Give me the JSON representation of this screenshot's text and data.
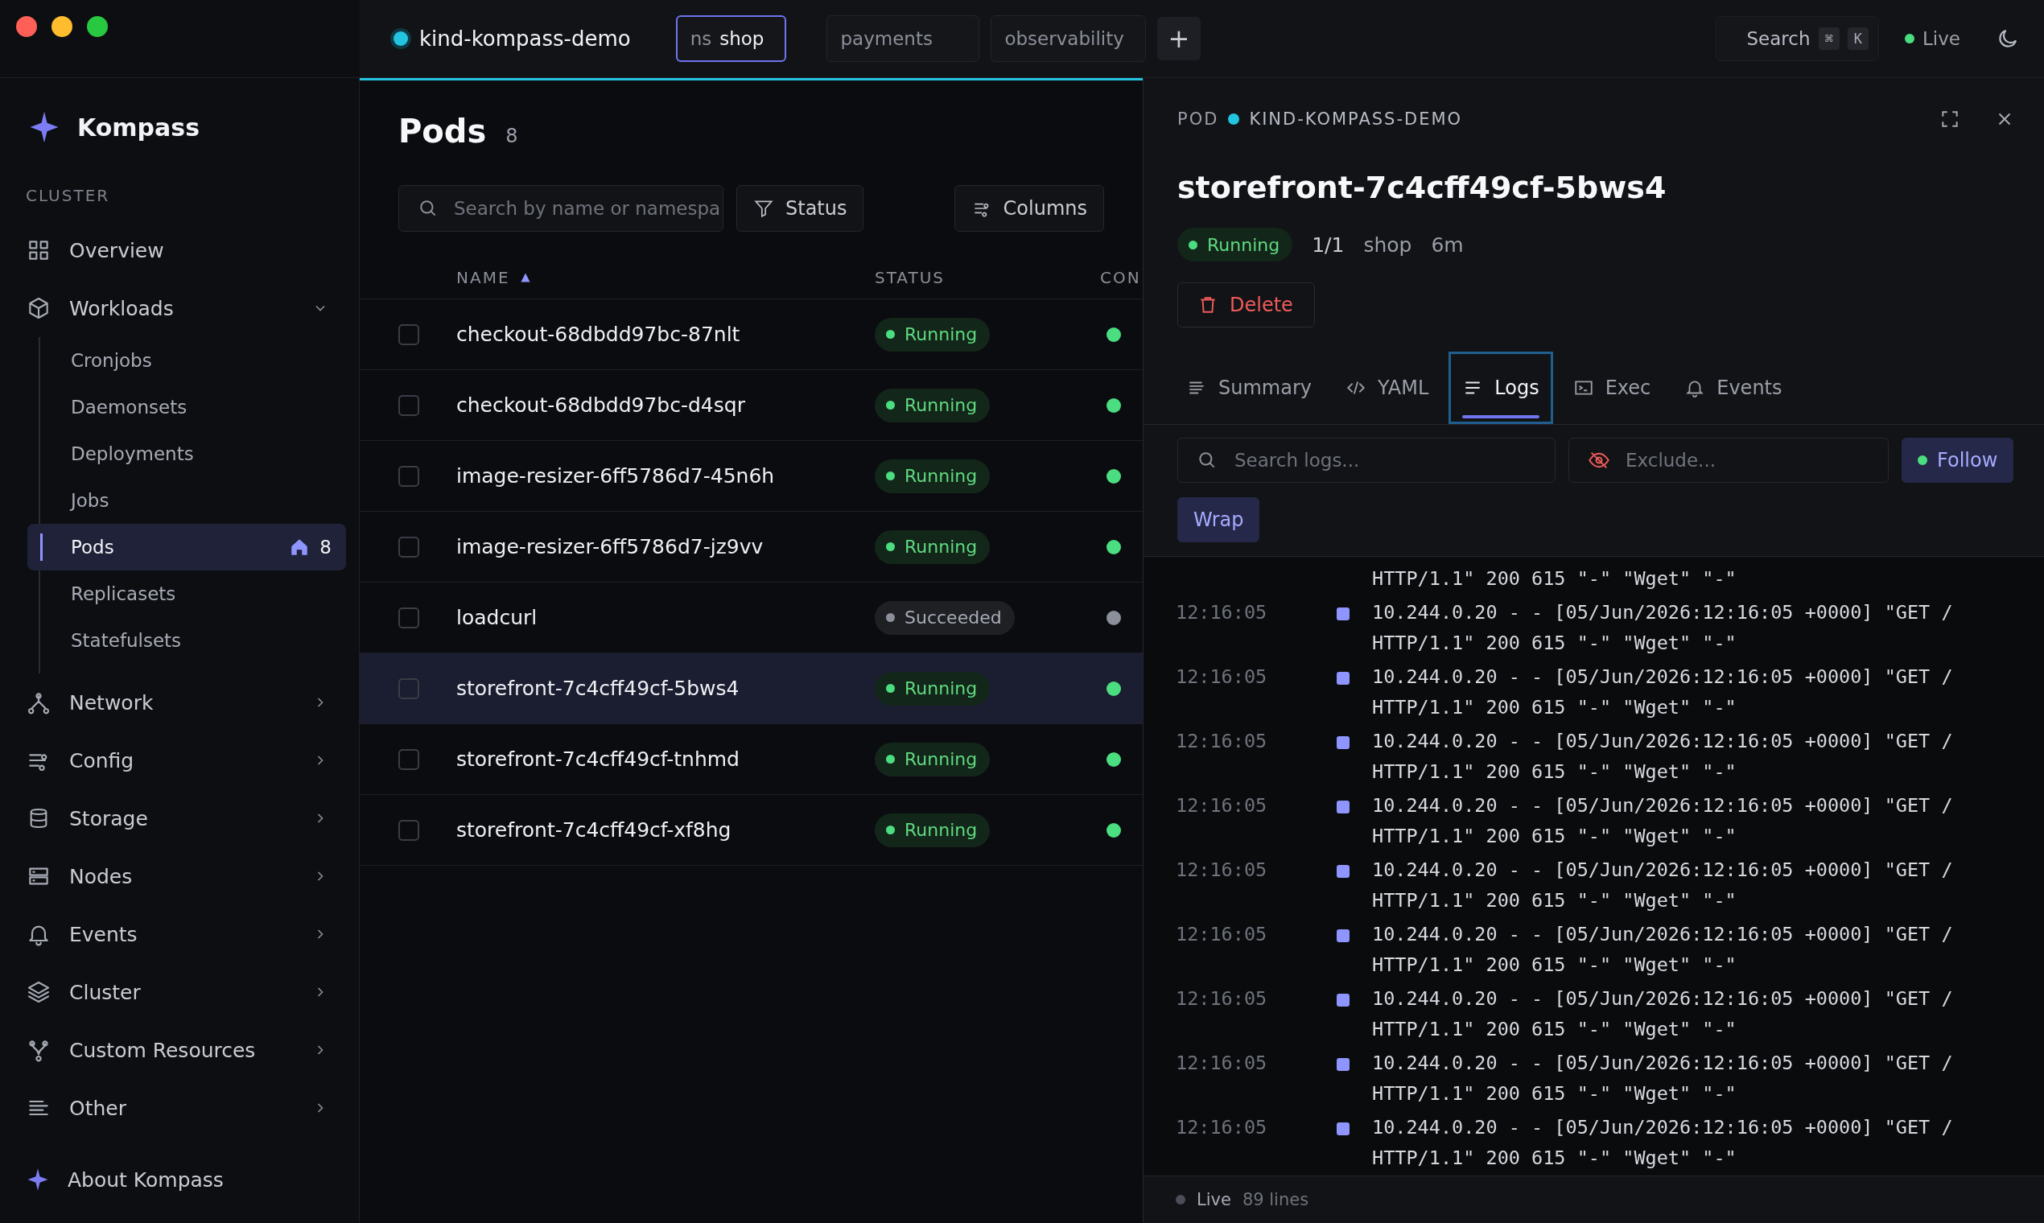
{
  "topbar": {
    "cluster": "kind-kompass-demo",
    "namespaces": [
      {
        "prefix": "ns",
        "label": "shop",
        "selected": true
      },
      {
        "label": "payments",
        "selected": false
      },
      {
        "label": "observability",
        "selected": false
      }
    ],
    "add": "+",
    "search": {
      "label": "Search",
      "keys": [
        "⌘",
        "K"
      ]
    },
    "live": "Live"
  },
  "sidebar": {
    "brand": "Kompass",
    "section": "CLUSTER",
    "items": [
      {
        "label": "Overview"
      },
      {
        "label": "Workloads",
        "expanded": true,
        "children": [
          {
            "label": "Cronjobs",
            "selected": false
          },
          {
            "label": "Daemonsets",
            "selected": false
          },
          {
            "label": "Deployments",
            "selected": false
          },
          {
            "label": "Jobs",
            "selected": false
          },
          {
            "label": "Pods",
            "selected": true,
            "badge": "8"
          },
          {
            "label": "Replicasets",
            "selected": false
          },
          {
            "label": "Statefulsets",
            "selected": false
          }
        ]
      },
      {
        "label": "Network",
        "expanded": false
      },
      {
        "label": "Config",
        "expanded": false
      },
      {
        "label": "Storage",
        "expanded": false
      },
      {
        "label": "Nodes",
        "expanded": false
      },
      {
        "label": "Events",
        "expanded": false
      },
      {
        "label": "Cluster",
        "expanded": false
      },
      {
        "label": "Custom Resources",
        "expanded": false
      },
      {
        "label": "Other",
        "expanded": false
      }
    ],
    "footer": "About Kompass"
  },
  "pods": {
    "title": "Pods",
    "count": "8",
    "search": {
      "placeholder": "Search by name or namespa"
    },
    "filter": "Status",
    "columns_button": "Columns",
    "columns": [
      {
        "label": "NAME",
        "sorted": true
      },
      {
        "label": "STATUS"
      },
      {
        "label": "CON"
      }
    ],
    "rows": [
      {
        "name": "checkout-68dbdd97bc-87nlt",
        "status": "Running",
        "kind": "running",
        "selected": false,
        "checked": false
      },
      {
        "name": "checkout-68dbdd97bc-d4sqr",
        "status": "Running",
        "kind": "running",
        "selected": false,
        "checked": false
      },
      {
        "name": "image-resizer-6ff5786d7-45n6h",
        "status": "Running",
        "kind": "running",
        "selected": false,
        "checked": false
      },
      {
        "name": "image-resizer-6ff5786d7-jz9vv",
        "status": "Running",
        "kind": "running",
        "selected": false,
        "checked": false
      },
      {
        "name": "loadcurl",
        "status": "Succeeded",
        "kind": "succeeded",
        "selected": false,
        "checked": false
      },
      {
        "name": "storefront-7c4cff49cf-5bws4",
        "status": "Running",
        "kind": "running",
        "selected": true,
        "checked": false
      },
      {
        "name": "storefront-7c4cff49cf-tnhmd",
        "status": "Running",
        "kind": "running",
        "selected": false,
        "checked": false
      },
      {
        "name": "storefront-7c4cff49cf-xf8hg",
        "status": "Running",
        "kind": "running",
        "selected": false,
        "checked": false
      }
    ]
  },
  "detail": {
    "kind_label": "POD",
    "cluster": "KIND-KOMPASS-DEMO",
    "title": "storefront-7c4cff49cf-5bws4",
    "status": {
      "label": "Running",
      "kind": "running"
    },
    "ready": "1/1",
    "namespace": "shop",
    "age": "6m",
    "delete": "Delete",
    "tabs": [
      {
        "label": "Summary",
        "selected": false
      },
      {
        "label": "YAML",
        "selected": false
      },
      {
        "label": "Logs",
        "selected": true
      },
      {
        "label": "Exec",
        "selected": false
      },
      {
        "label": "Events",
        "selected": false
      }
    ],
    "log_search": {
      "placeholder": "Search logs..."
    },
    "exclude": {
      "placeholder": "Exclude..."
    },
    "follow": {
      "label": "Follow",
      "on": true
    },
    "wrap": {
      "label": "Wrap",
      "on": true
    },
    "log_partial": "HTTP/1.1\" 200 615 \"-\" \"Wget\" \"-\"",
    "logs": [
      {
        "time": "12:16:05",
        "text": "10.244.0.20 - - [05/Jun/2026:12:16:05 +0000] \"GET / HTTP/1.1\" 200 615 \"-\" \"Wget\" \"-\""
      },
      {
        "time": "12:16:05",
        "text": "10.244.0.20 - - [05/Jun/2026:12:16:05 +0000] \"GET / HTTP/1.1\" 200 615 \"-\" \"Wget\" \"-\""
      },
      {
        "time": "12:16:05",
        "text": "10.244.0.20 - - [05/Jun/2026:12:16:05 +0000] \"GET / HTTP/1.1\" 200 615 \"-\" \"Wget\" \"-\""
      },
      {
        "time": "12:16:05",
        "text": "10.244.0.20 - - [05/Jun/2026:12:16:05 +0000] \"GET / HTTP/1.1\" 200 615 \"-\" \"Wget\" \"-\""
      },
      {
        "time": "12:16:05",
        "text": "10.244.0.20 - - [05/Jun/2026:12:16:05 +0000] \"GET / HTTP/1.1\" 200 615 \"-\" \"Wget\" \"-\""
      },
      {
        "time": "12:16:05",
        "text": "10.244.0.20 - - [05/Jun/2026:12:16:05 +0000] \"GET / HTTP/1.1\" 200 615 \"-\" \"Wget\" \"-\""
      },
      {
        "time": "12:16:05",
        "text": "10.244.0.20 - - [05/Jun/2026:12:16:05 +0000] \"GET / HTTP/1.1\" 200 615 \"-\" \"Wget\" \"-\""
      },
      {
        "time": "12:16:05",
        "text": "10.244.0.20 - - [05/Jun/2026:12:16:05 +0000] \"GET / HTTP/1.1\" 200 615 \"-\" \"Wget\" \"-\""
      },
      {
        "time": "12:16:05",
        "text": "10.244.0.20 - - [05/Jun/2026:12:16:05 +0000] \"GET / HTTP/1.1\" 200 615 \"-\" \"Wget\" \"-\""
      }
    ],
    "footer": {
      "live": "Live",
      "live_on": false,
      "lines": "89 lines"
    }
  }
}
